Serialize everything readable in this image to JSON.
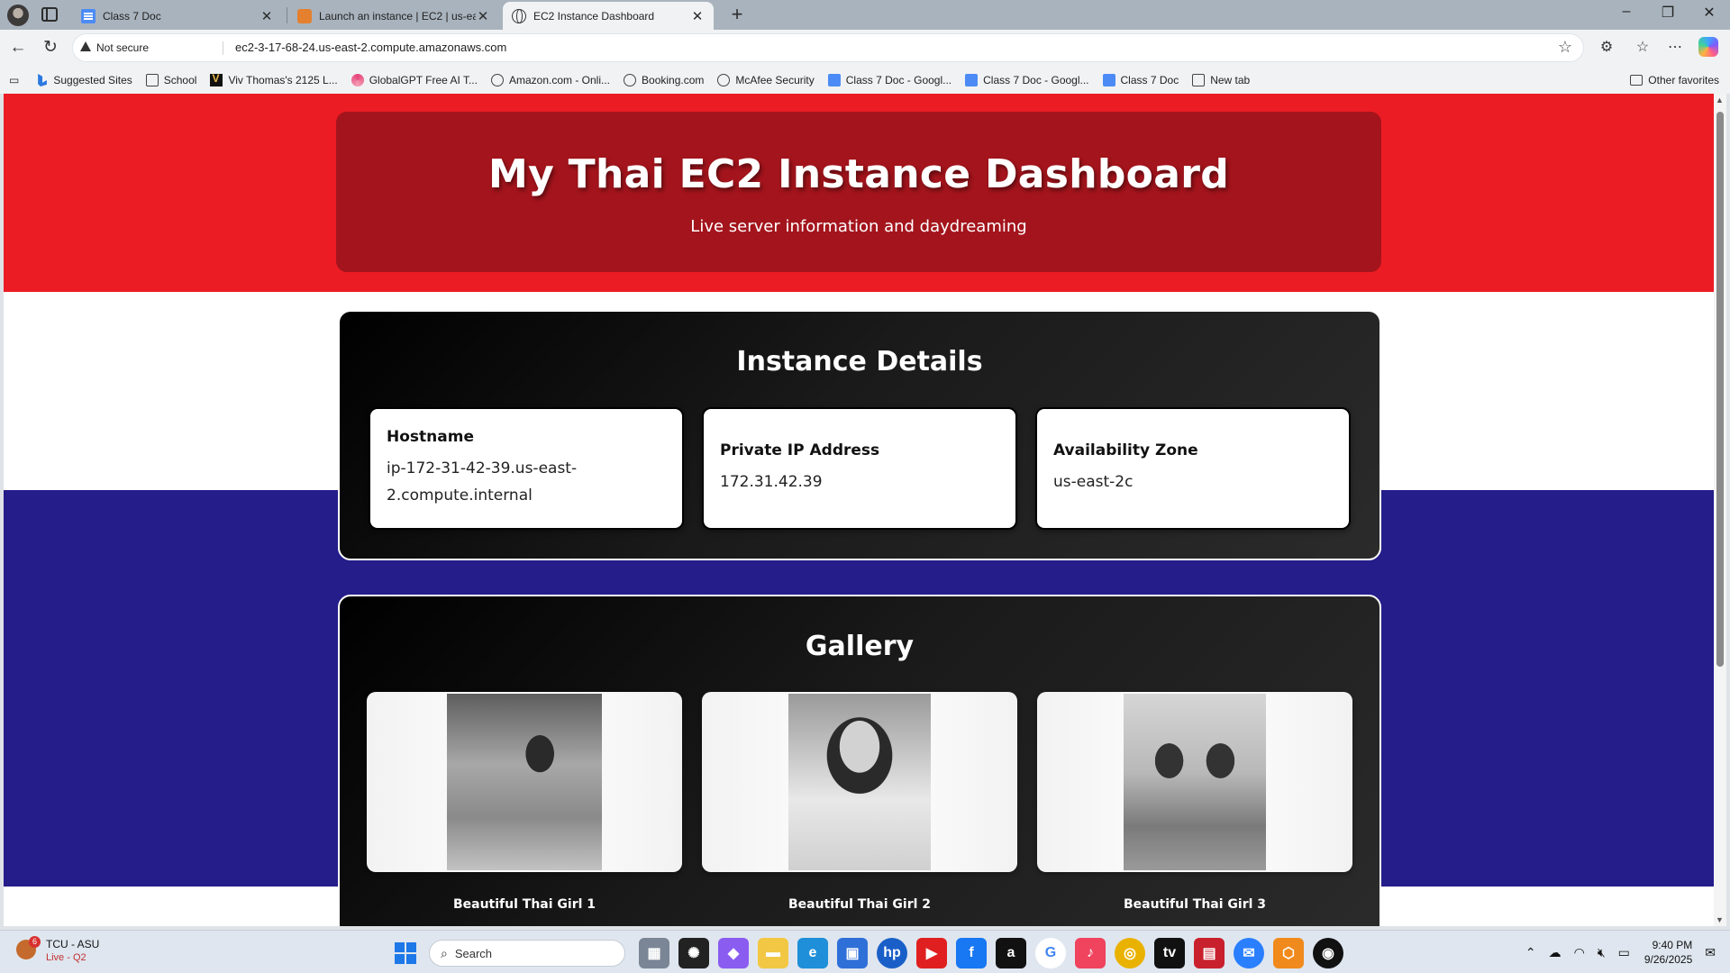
{
  "browser": {
    "tabs": [
      {
        "title": "Class 7 Doc",
        "icon": "google-docs-icon"
      },
      {
        "title": "Launch an instance | EC2 | us-east-",
        "icon": "aws-icon"
      },
      {
        "title": "EC2 Instance Dashboard",
        "icon": "globe-icon",
        "active": true
      }
    ],
    "new_tab": "+",
    "window_controls": {
      "minimize": "–",
      "maximize": "❐",
      "close": "✕"
    },
    "address": {
      "security_label": "Not secure",
      "url": "ec2-3-17-68-24.us-east-2.compute.amazonaws.com"
    },
    "favorites": [
      {
        "label": "Suggested Sites",
        "icon": "bing-icon"
      },
      {
        "label": "School",
        "icon": "folder-icon"
      },
      {
        "label": "Viv Thomas's 2125 L...",
        "icon": "v-icon"
      },
      {
        "label": "GlobalGPT Free AI T...",
        "icon": "swirl-icon"
      },
      {
        "label": "Amazon.com - Onli...",
        "icon": "globe-icon"
      },
      {
        "label": "Booking.com",
        "icon": "globe-icon"
      },
      {
        "label": "McAfee Security",
        "icon": "globe-icon"
      },
      {
        "label": "Class 7 Doc - Googl...",
        "icon": "google-docs-icon"
      },
      {
        "label": "Class 7 Doc - Googl...",
        "icon": "google-docs-icon"
      },
      {
        "label": "Class 7 Doc",
        "icon": "google-docs-icon"
      },
      {
        "label": "New tab",
        "icon": "new-tab-icon"
      }
    ],
    "other_favorites": "Other favorites"
  },
  "page": {
    "hero": {
      "title": "My Thai EC2 Instance Dashboard",
      "subtitle": "Live server information and daydreaming"
    },
    "details": {
      "title": "Instance Details",
      "cards": [
        {
          "label": "Hostname",
          "value": "ip-172-31-42-39.us-east-2.compute.internal"
        },
        {
          "label": "Private IP Address",
          "value": "172.31.42.39"
        },
        {
          "label": "Availability Zone",
          "value": "us-east-2c"
        }
      ]
    },
    "gallery": {
      "title": "Gallery",
      "items": [
        {
          "caption": "Beautiful Thai Girl 1"
        },
        {
          "caption": "Beautiful Thai Girl 2"
        },
        {
          "caption": "Beautiful Thai Girl 3"
        }
      ]
    }
  },
  "taskbar": {
    "game_badge": "6",
    "score": "TCU - ASU",
    "score_sub": "Live - Q2",
    "search_placeholder": "Search",
    "time": "9:40 PM",
    "date": "9/26/2025"
  },
  "colors": {
    "flag_red": "#ec1c24",
    "flag_white": "#ffffff",
    "flag_blue": "#241d8a",
    "hero_bg": "#a4141c"
  }
}
